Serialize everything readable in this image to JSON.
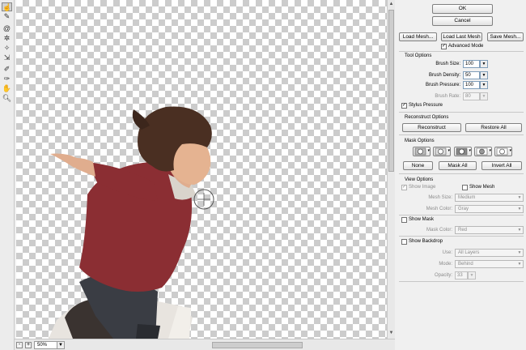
{
  "toolbar": {
    "tools": [
      "forward-warp-tool",
      "reconstruct-tool",
      "twirl-tool",
      "pucker-tool",
      "bloat-tool",
      "push-left-tool",
      "freeze-mask-tool",
      "thaw-mask-tool",
      "hand-tool",
      "zoom-tool"
    ]
  },
  "status": {
    "zoom": "50%"
  },
  "buttons": {
    "ok": "OK",
    "cancel": "Cancel",
    "load_mesh": "Load Mesh...",
    "load_last_mesh": "Load Last Mesh",
    "save_mesh": "Save Mesh...",
    "reconstruct": "Reconstruct",
    "restore_all": "Restore All",
    "none": "None",
    "mask_all": "Mask All",
    "invert_all": "Invert All"
  },
  "advanced_mode": {
    "label": "Advanced Mode",
    "checked": true
  },
  "tool_options": {
    "title": "Tool Options",
    "brush_size": {
      "label": "Brush Size:",
      "value": "100"
    },
    "brush_density": {
      "label": "Brush Density:",
      "value": "50"
    },
    "brush_pressure": {
      "label": "Brush Pressure:",
      "value": "100"
    },
    "brush_rate": {
      "label": "Brush Rate:",
      "value": "80"
    },
    "stylus_pressure": {
      "label": "Stylus Pressure",
      "checked": true
    }
  },
  "reconstruct_options": {
    "title": "Reconstruct Options"
  },
  "mask_options": {
    "title": "Mask Options"
  },
  "view_options": {
    "title": "View Options",
    "show_image": "Show Image",
    "show_mesh": "Show Mesh",
    "mesh_size_label": "Mesh Size:",
    "mesh_size": "Medium",
    "mesh_color_label": "Mesh Color:",
    "mesh_color": "Gray"
  },
  "show_mask": {
    "label": "Show Mask",
    "mask_color_label": "Mask Color:",
    "mask_color": "Red"
  },
  "show_backdrop": {
    "label": "Show Backdrop",
    "use_label": "Use:",
    "use": "All Layers",
    "mode_label": "Mode:",
    "mode": "Behind",
    "opacity_label": "Opacity:",
    "opacity": "33"
  }
}
